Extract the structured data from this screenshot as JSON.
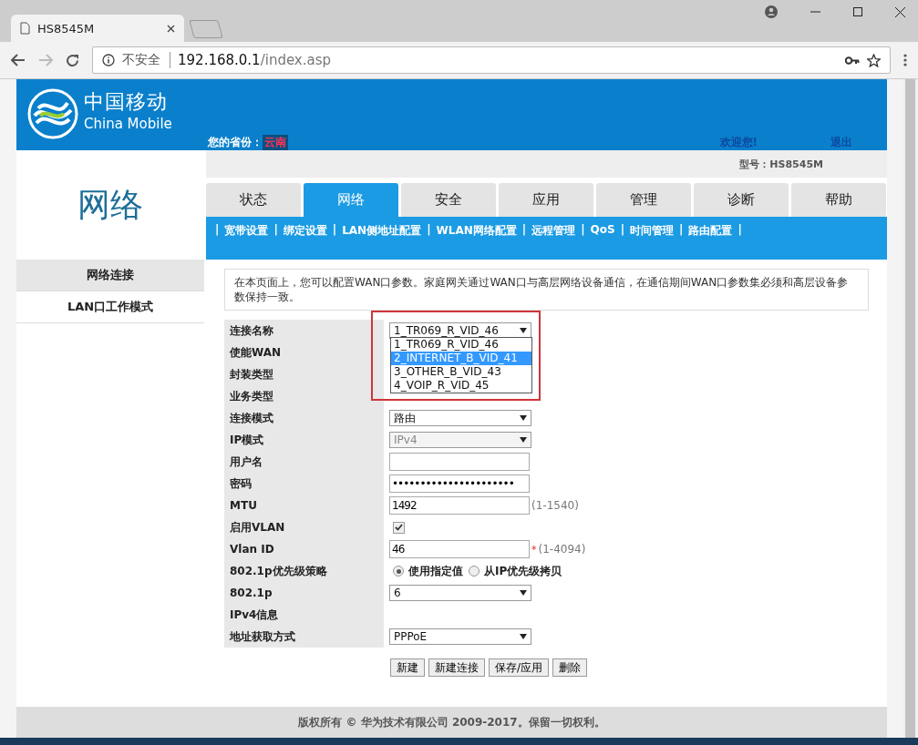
{
  "browser": {
    "tab_title": "HS8545M",
    "security": "不安全",
    "host": "192.168.0.1",
    "path": "/index.asp"
  },
  "header": {
    "logo_cn": "中国移动",
    "logo_en": "China Mobile",
    "province_label": "您的省份：",
    "province": "云南",
    "welcome": "欢迎您!",
    "logout": "退出",
    "model": "型号：HS8545M"
  },
  "section_title": "网络",
  "sidebar": [
    {
      "label": "网络连接",
      "selected": true
    },
    {
      "label": "LAN口工作模式",
      "selected": false
    }
  ],
  "tabs": [
    {
      "label": "状态",
      "selected": false
    },
    {
      "label": "网络",
      "selected": true
    },
    {
      "label": "安全",
      "selected": false
    },
    {
      "label": "应用",
      "selected": false
    },
    {
      "label": "管理",
      "selected": false
    },
    {
      "label": "诊断",
      "selected": false
    },
    {
      "label": "帮助",
      "selected": false
    }
  ],
  "subnav_separator": "|",
  "subnav": [
    "宽带设置",
    "绑定设置",
    "LAN侧地址配置",
    "WLAN网络配置",
    "远程管理",
    "QoS",
    "时间管理",
    "路由配置"
  ],
  "description": "在本页面上，您可以配置WAN口参数。家庭网关通过WAN口与高层网络设备通信，在通信期间WAN口参数集必须和高层设备参数保持一致。",
  "form": [
    {
      "label": "连接名称",
      "kind": "select",
      "value": "1_TR069_R_VID_46",
      "open": true
    },
    {
      "label": "使能WAN",
      "kind": "empty"
    },
    {
      "label": "封装类型",
      "kind": "empty"
    },
    {
      "label": "业务类型",
      "kind": "empty"
    },
    {
      "label": "连接模式",
      "kind": "select",
      "value": "路由"
    },
    {
      "label": "IP模式",
      "kind": "select",
      "value": "IPv4",
      "disabled": true
    },
    {
      "label": "用户名",
      "kind": "text"
    },
    {
      "label": "密码",
      "kind": "text",
      "value": "••••••••••••••••••••••"
    },
    {
      "label": "MTU",
      "kind": "text",
      "value": "1492",
      "hint": "(1-1540)"
    },
    {
      "label": "启用VLAN",
      "kind": "checkbox",
      "checked": true
    },
    {
      "label": "Vlan ID",
      "kind": "text",
      "value": "46",
      "required": "*",
      "hint": "(1-4094)"
    },
    {
      "label": "802.1p优先级策略",
      "kind": "radio",
      "options": [
        {
          "label": "使用指定值",
          "selected": true
        },
        {
          "label": "从IP优先级拷贝",
          "selected": false
        }
      ]
    },
    {
      "label": "802.1p",
      "kind": "select",
      "value": "6"
    },
    {
      "label": "IPv4信息",
      "kind": "empty"
    },
    {
      "label": "地址获取方式",
      "kind": "select",
      "value": "PPPoE"
    }
  ],
  "dropdown_options": [
    {
      "label": "1_TR069_R_VID_46",
      "selected": false
    },
    {
      "label": "2_INTERNET_B_VID_41",
      "selected": true
    },
    {
      "label": "3_OTHER_B_VID_43",
      "selected": false
    },
    {
      "label": "4_VOIP_R_VID_45",
      "selected": false
    }
  ],
  "buttons": [
    "新建",
    "新建连接",
    "保存/应用",
    "删除"
  ],
  "footer": "版权所有 © 华为技术有限公司 2009-2017。保留一切权利。"
}
